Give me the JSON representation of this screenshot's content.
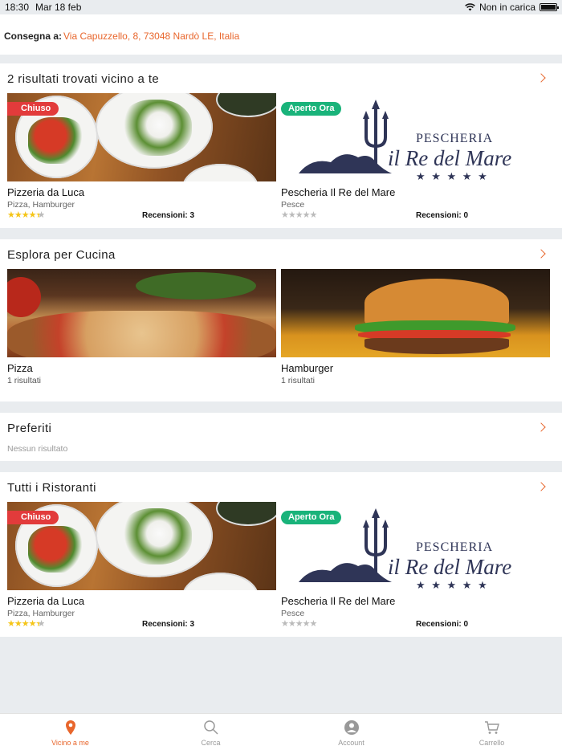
{
  "status_bar": {
    "time": "18:30",
    "date": "Mar 18 feb",
    "network": "Non in carica"
  },
  "delivery": {
    "label": "Consegna a:",
    "address": "Via Capuzzello, 8, 73048 Nardò LE, Italia"
  },
  "nearby": {
    "title": "2 risultati trovati vicino a te",
    "restaurants": [
      {
        "badge": "Chiuso",
        "name": "Pizzeria da Luca",
        "cuisine": "Pizza, Hamburger",
        "rating": 4.5,
        "reviews": "Recensioni: 3"
      },
      {
        "badge": "Aperto Ora",
        "name": "Pescheria Il Re del Mare",
        "cuisine": "Pesce",
        "rating": 0,
        "reviews": "Recensioni: 0"
      }
    ]
  },
  "logo": {
    "line1": "PESCHERIA",
    "line2": "il Re del Mare"
  },
  "cuisines": {
    "title": "Esplora per Cucina",
    "items": [
      {
        "name": "Pizza",
        "count": "1 risultati"
      },
      {
        "name": "Hamburger",
        "count": "1 risultati"
      }
    ]
  },
  "favorites": {
    "title": "Preferiti",
    "empty": "Nessun risultato"
  },
  "all": {
    "title": "Tutti i Ristoranti",
    "restaurants": [
      {
        "badge": "Chiuso",
        "name": "Pizzeria da Luca",
        "cuisine": "Pizza, Hamburger",
        "rating": 4.5,
        "reviews": "Recensioni: 3"
      },
      {
        "badge": "Aperto Ora",
        "name": "Pescheria Il Re del Mare",
        "cuisine": "Pesce",
        "rating": 0,
        "reviews": "Recensioni: 0"
      }
    ]
  },
  "tabs": [
    {
      "label": "Vicino a me",
      "icon": "location-pin-icon",
      "active": true
    },
    {
      "label": "Cerca",
      "icon": "search-icon",
      "active": false
    },
    {
      "label": "Account",
      "icon": "account-icon",
      "active": false
    },
    {
      "label": "Carrello",
      "icon": "cart-icon",
      "active": false
    }
  ],
  "colors": {
    "accent": "#e8662c",
    "closed": "#e23b3b",
    "open": "#19b37a",
    "star": "#f5c518"
  }
}
